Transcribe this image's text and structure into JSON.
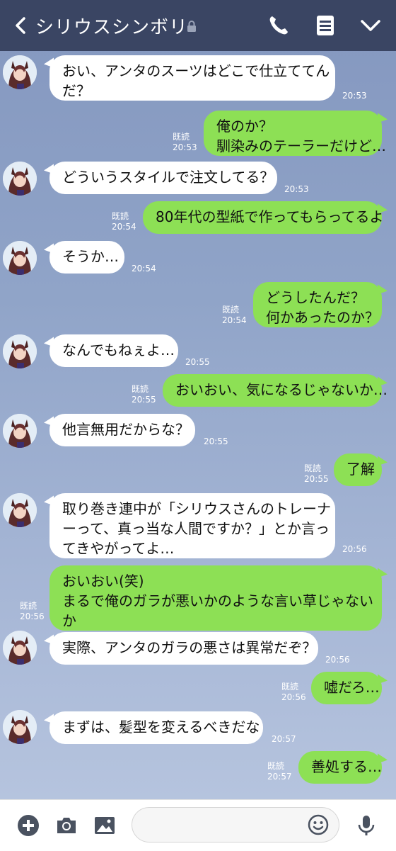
{
  "header": {
    "title": "シリウスシンボリ"
  },
  "read_label": "既読",
  "messages": [
    {
      "side": "in",
      "lines": [
        "おい、アンタのスーツはどこで仕立ててん",
        "だ？"
      ],
      "time": "20:53"
    },
    {
      "side": "out",
      "lines": [
        "俺のか？",
        "馴染みのテーラーだけど…"
      ],
      "time": "20:53"
    },
    {
      "side": "in",
      "lines": [
        "どういうスタイルで注文してる？"
      ],
      "time": "20:53"
    },
    {
      "side": "out",
      "lines": [
        "80年代の型紙で作ってもらってるよ"
      ],
      "time": "20:54"
    },
    {
      "side": "in",
      "lines": [
        "そうか…"
      ],
      "time": "20:54"
    },
    {
      "side": "out",
      "lines": [
        "どうしたんだ？",
        "何かあったのか？"
      ],
      "time": "20:54"
    },
    {
      "side": "in",
      "lines": [
        "なんでもねぇよ…"
      ],
      "time": "20:55"
    },
    {
      "side": "out",
      "lines": [
        "おいおい、気になるじゃないか…"
      ],
      "time": "20:55"
    },
    {
      "side": "in",
      "lines": [
        "他言無用だからな？"
      ],
      "time": "20:55"
    },
    {
      "side": "out",
      "lines": [
        "了解"
      ],
      "time": "20:55"
    },
    {
      "side": "in",
      "lines": [
        "取り巻き連中が「シリウスさんのトレーナ",
        "ーって、真っ当な人間ですか？」とか言っ",
        "てきやがってよ…"
      ],
      "time": "20:56"
    },
    {
      "side": "out",
      "lines": [
        "おいおい(笑)",
        "まるで俺のガラが悪いかのような言い草じゃない",
        "か"
      ],
      "time": "20:56"
    },
    {
      "side": "in",
      "lines": [
        "実際、アンタのガラの悪さは異常だぞ？"
      ],
      "time": "20:56"
    },
    {
      "side": "out",
      "lines": [
        "嘘だろ…"
      ],
      "time": "20:56"
    },
    {
      "side": "in",
      "lines": [
        "まずは、髪型を変えるべきだな"
      ],
      "time": "20:57"
    },
    {
      "side": "out",
      "lines": [
        "善処する…"
      ],
      "time": "20:57"
    }
  ]
}
